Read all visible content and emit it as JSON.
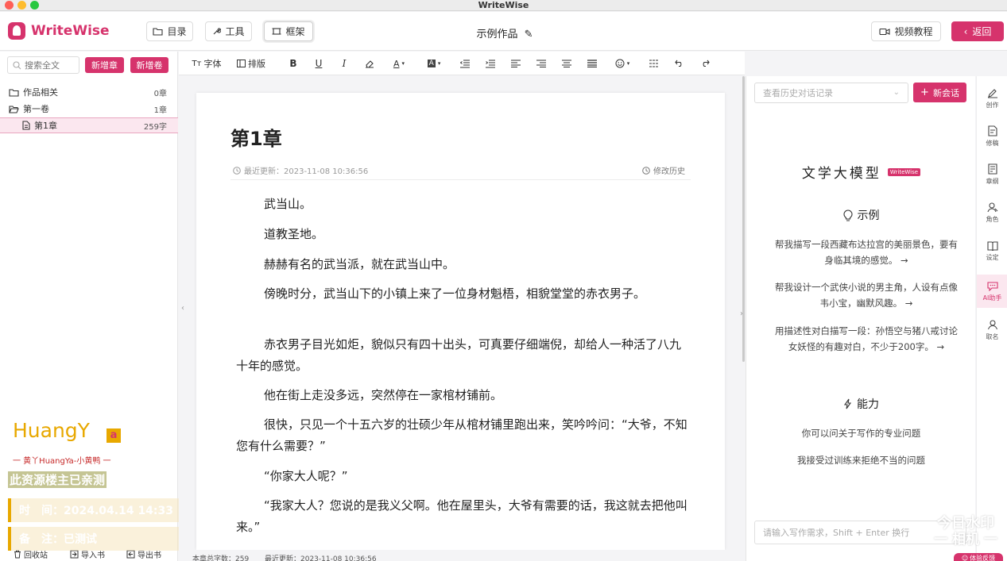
{
  "window": {
    "title": "WriteWise"
  },
  "header": {
    "logo_text": "WriteWise",
    "catalog_label": "目录",
    "tools_label": "工具",
    "frame_label": "框架",
    "doc_title": "示例作品",
    "video_label": "视频教程",
    "back_label": "返回"
  },
  "sidebar": {
    "search_placeholder": "搜索全文",
    "new_chapter_label": "新增章",
    "new_volume_label": "新增卷",
    "tree": [
      {
        "label": "作品相关",
        "count": "0章"
      },
      {
        "label": "第一卷",
        "count": "1章"
      },
      {
        "label": "第1章",
        "count": "259字"
      }
    ],
    "footer": {
      "recycle_label": "回收站",
      "import_label": "导入书",
      "export_label": "导出书"
    }
  },
  "toolbar": {
    "font_label": "字体",
    "layout_label": "排版"
  },
  "editor": {
    "chapter_title": "第1章",
    "last_updated": "最近更新：2023-11-08 10:36:56",
    "history_label": "修改历史",
    "paragraphs": [
      "武当山。",
      "道教圣地。",
      "赫赫有名的武当派，就在武当山中。",
      "傍晚时分，武当山下的小镇上来了一位身材魁梧，相貌堂堂的赤衣男子。",
      "赤衣男子目光如炬，貌似只有四十出头，可真要仔细端倪，却给人一种活了八九十年的感觉。",
      "他在街上走没多远，突然停在一家棺材铺前。",
      "很快，只见一个十五六岁的壮硕少年从棺材铺里跑出来，笑吟吟问：“大爷，不知您有什么需要？”",
      "“你家大人呢？”",
      "“我家大人？您说的是我义父啊。他在屋里头，大爷有需要的话，我这就去把他叫来。”"
    ],
    "status": {
      "word_count": "本章总字数：259",
      "updated": "最近更新：2023-11-08 10:36:56"
    }
  },
  "chat": {
    "history_placeholder": "查看历史对话记录",
    "new_chat_label": "新会话",
    "model_title": "文学大模型",
    "model_badge": "WriteWise",
    "examples_title": "示例",
    "examples": [
      "帮我描写一段西藏布达拉宫的美丽景色，要有身临其境的感觉。 →",
      "帮我设计一个武侠小说的男主角，人设有点像韦小宝，幽默风趣。 →",
      "用描述性对白描写一段：孙悟空与猪八戒讨论女妖怪的有趣对白，不少于200字。 →"
    ],
    "capabilities_title": "能力",
    "capabilities": [
      "你可以问关于写作的专业问题",
      "我接受过训练来拒绝不当的问题"
    ],
    "input_placeholder": "请输入写作需求，Shift + Enter 换行"
  },
  "rail": [
    {
      "label": "创作",
      "icon": "pen-icon"
    },
    {
      "label": "修稿",
      "icon": "revise-icon"
    },
    {
      "label": "章纲",
      "icon": "outline-icon"
    },
    {
      "label": "角色",
      "icon": "character-icon"
    },
    {
      "label": "设定",
      "icon": "book-icon"
    },
    {
      "label": "AI助手",
      "icon": "chat-icon"
    },
    {
      "label": "取名",
      "icon": "user-icon"
    }
  ],
  "feedback_label": "体验反馈",
  "watermark": {
    "brand_huang": "HuangY",
    "brand_a": "a",
    "brand_sub": "一 黄丫HuangYa-小黄鸭 一",
    "tested": "此资源楼主已亲测",
    "time": "时　间：2024.04.14 14:33",
    "note": "备　注：已测试",
    "br_line1": "今日水印",
    "br_line2": "一 相机 一"
  }
}
